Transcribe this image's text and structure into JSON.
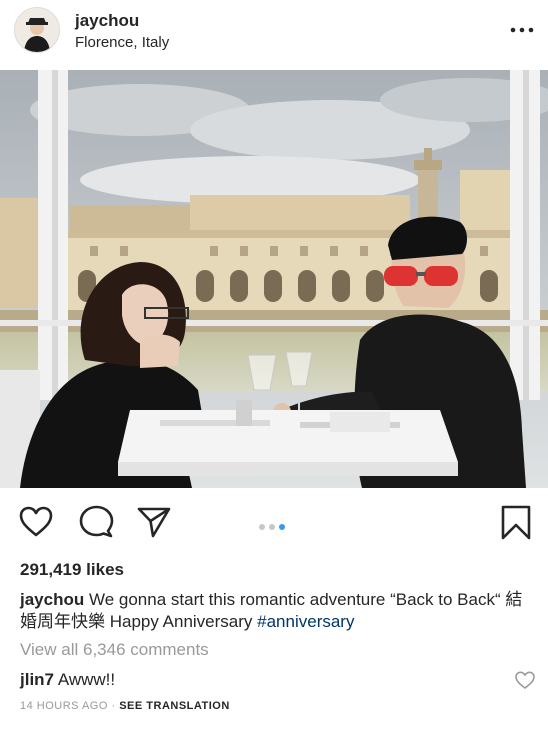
{
  "post": {
    "username": "jaychou",
    "location": "Florence, Italy",
    "likes": "291,419 likes",
    "caption_user": "jaychou",
    "caption_text": "We gonna start this romantic adventure “Back to Back“ 結婚周年快樂 Happy Anniversary",
    "caption_hashtag": "#anniversary",
    "view_all": "View all 6,346 comments",
    "carousel": {
      "count": 3,
      "active_index": 2
    }
  },
  "comments": [
    {
      "user": "jlin7",
      "text": "Awww!!"
    }
  ],
  "meta": {
    "time": "14 HOURS AGO",
    "separator": "·",
    "translate": "SEE TRANSLATION"
  },
  "icons": {
    "more": "more-options-icon",
    "like": "heart-icon",
    "comment": "comment-icon",
    "share": "direct-share-icon",
    "save": "bookmark-icon",
    "comment_like": "heart-icon"
  },
  "colors": {
    "text": "#262626",
    "muted": "#999999",
    "link": "#003569",
    "carousel_active": "#3897f0",
    "carousel_inactive": "#c7c7c7"
  }
}
